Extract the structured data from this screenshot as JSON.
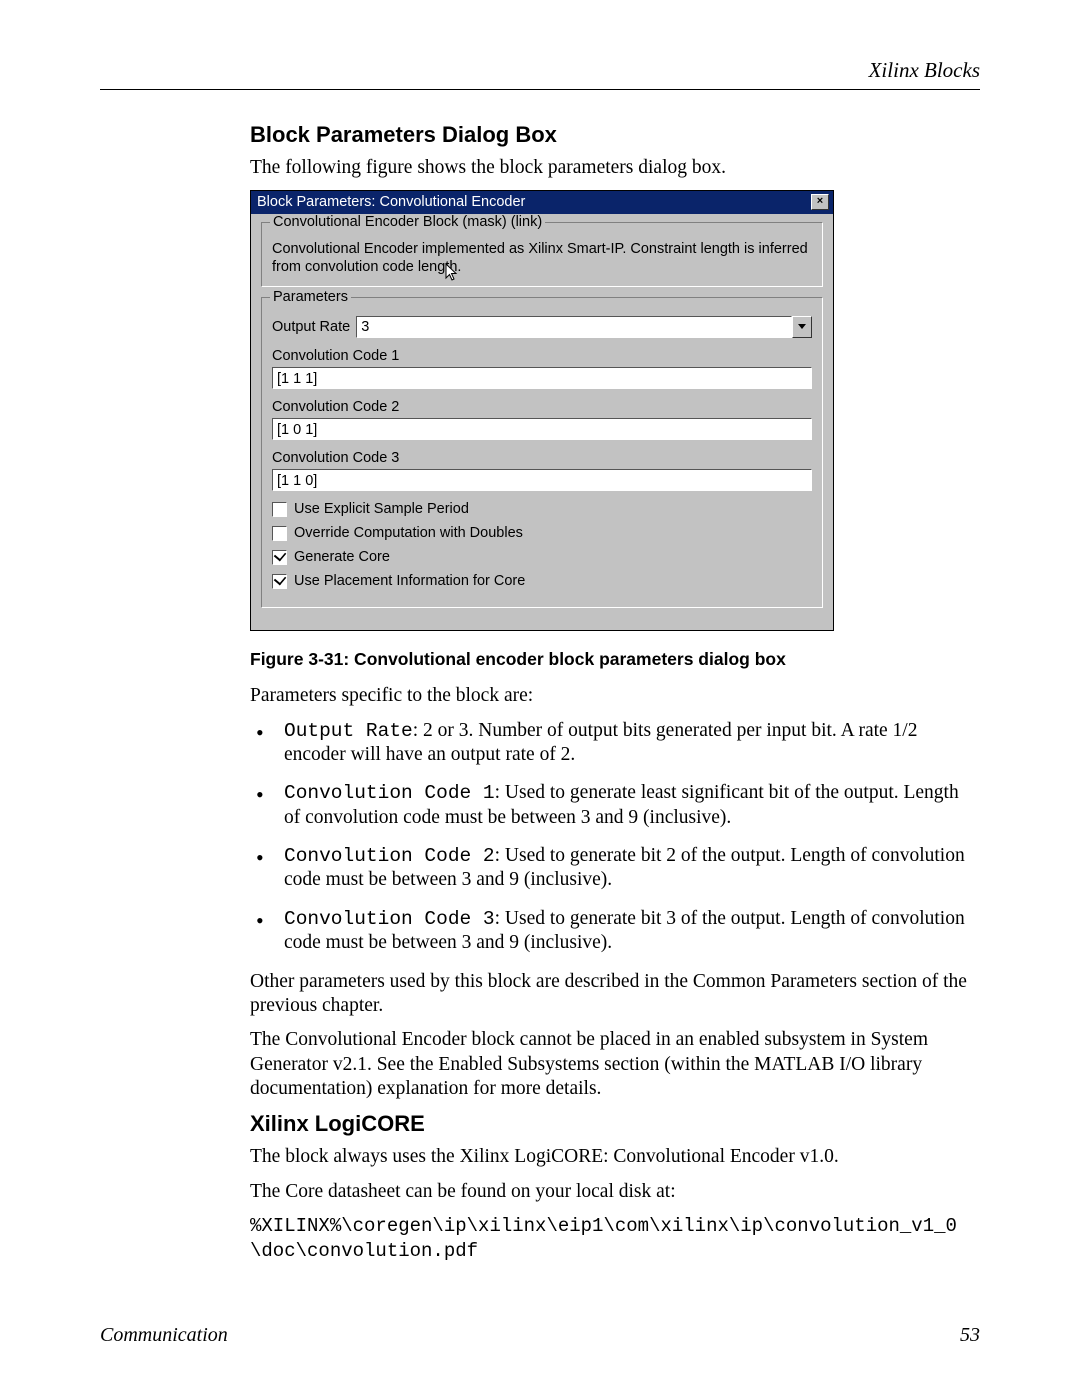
{
  "header": {
    "right": "Xilinx Blocks"
  },
  "section1": {
    "title": "Block Parameters Dialog Box",
    "intro": "The following figure shows the block parameters dialog box."
  },
  "dialog": {
    "title": "Block Parameters: Convolutional Encoder",
    "mask_legend": "Convolutional Encoder Block (mask) (link)",
    "mask_desc": "Convolutional Encoder implemented as Xilinx Smart-IP. Constraint length is inferred from convolution code length.",
    "params_legend": "Parameters",
    "output_rate_label": "Output Rate",
    "output_rate_value": "3",
    "cc1_label": "Convolution Code 1",
    "cc1_value": "[1 1 1]",
    "cc2_label": "Convolution Code 2",
    "cc2_value": "[1 0 1]",
    "cc3_label": "Convolution Code 3",
    "cc3_value": "[1 1 0]",
    "chk_explicit": "Use Explicit Sample Period",
    "chk_override": "Override Computation with Doubles",
    "chk_generate": "Generate Core",
    "chk_placement": "Use Placement Information for Core"
  },
  "figure_caption": "Figure 3-31:   Convolutional encoder block parameters dialog box",
  "after_fig": {
    "p1": "Parameters specific to the block are:",
    "b1_code": "Output Rate",
    "b1_rest": ": 2 or 3.  Number of output bits generated per input bit. A rate 1/2 encoder will have an output rate of 2.",
    "b2_code": "Convolution Code 1",
    "b2_rest": ": Used to generate least significant bit of the output. Length of convolution code must be between 3 and 9 (inclusive).",
    "b3_code": "Convolution Code 2",
    "b3_rest": ": Used to generate bit 2 of the output.  Length of convolution code must be between 3 and 9 (inclusive).",
    "b4_code": "Convolution Code 3",
    "b4_rest": ": Used to generate bit 3 of the output.  Length of convolution code must be between 3 and 9 (inclusive).",
    "p2": "Other parameters used by this block are described in the Common Parameters section of the previous chapter.",
    "p3": "The Convolutional Encoder block cannot be placed in an enabled subsystem in System Generator v2.1. See the Enabled Subsystems section (within the MATLAB I/O library documentation) explanation for more details."
  },
  "section2": {
    "title": "Xilinx LogiCORE",
    "p1": "The block always uses the Xilinx LogiCORE: Convolutional Encoder v1.0.",
    "p2": "The Core datasheet can be found on your local disk at:",
    "path": "%XILINX%\\coregen\\ip\\xilinx\\eip1\\com\\xilinx\\ip\\convolution_v1_0\\doc\\convolution.pdf"
  },
  "footer": {
    "left": "Communication",
    "right": "53"
  }
}
